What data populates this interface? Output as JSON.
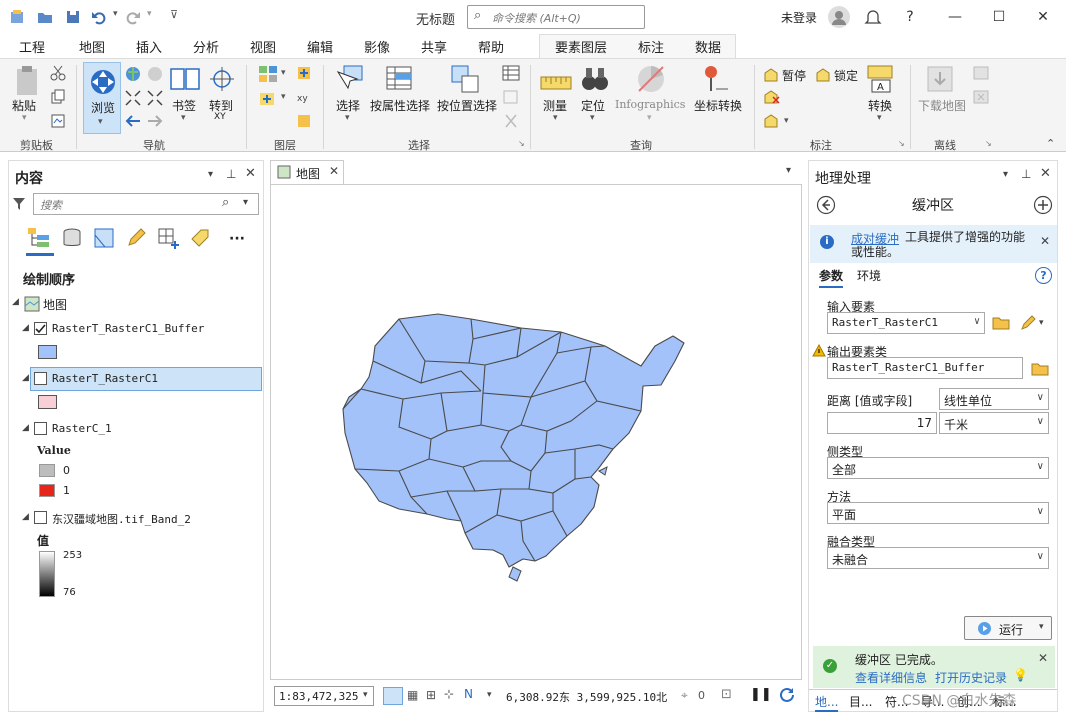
{
  "app": {
    "title": "无标题",
    "command_search_placeholder": "命令搜索 (Alt+Q)",
    "login": "未登录"
  },
  "tabs": [
    "工程",
    "地图",
    "插入",
    "分析",
    "视图",
    "编辑",
    "影像",
    "共享",
    "帮助"
  ],
  "active_tab": "地图",
  "context_tabs": [
    "要素图层",
    "标注",
    "数据"
  ],
  "ribbon": {
    "clipboard": {
      "paste": "粘贴",
      "group": "剪贴板"
    },
    "navigate": {
      "explore": "浏览",
      "bookmarks": "书签",
      "goto": "转到",
      "goto_sub": "XY",
      "group": "导航"
    },
    "layer": {
      "group": "图层"
    },
    "selection": {
      "select": "选择",
      "by_attr": "按属性选择",
      "by_loc": "按位置选择",
      "group": "选择"
    },
    "inquiry": {
      "measure": "测量",
      "locate": "定位",
      "infographics": "Infographics",
      "convert_coords": "坐标转换",
      "group": "查询"
    },
    "labeling": {
      "pause": "暂停",
      "lock": "锁定",
      "convert": "转换",
      "group": "标注"
    },
    "offline": {
      "download_map": "下载地图",
      "group": "离线"
    }
  },
  "contents": {
    "title": "内容",
    "search_placeholder": "搜索",
    "draw_order": "绘制顺序",
    "map_name": "地图",
    "layers": [
      {
        "name": "RasterT_RasterC1_Buffer",
        "checked": true,
        "swatch": "#a3c2fa"
      },
      {
        "name": "RasterT_RasterC1",
        "checked": false,
        "swatch": "#f9cfd6",
        "selected": true
      },
      {
        "name": "RasterC_1",
        "checked": false,
        "legend_title": "Value",
        "classes": [
          {
            "label": "0",
            "color": "#bdbdbd"
          },
          {
            "label": "1",
            "color": "#e8251b"
          }
        ]
      },
      {
        "name": "东汉疆域地图.tif_Band_2",
        "checked": false,
        "legend_title": "值",
        "high": "253",
        "low": "76"
      }
    ]
  },
  "map_view": {
    "tab_label": "地图",
    "fill_color": "#a3c2fa",
    "scale": "1:83,472,325",
    "coords": "6,308.92东  3,599,925.10北",
    "selected_count": "0"
  },
  "geoprocessing": {
    "title": "地理处理",
    "tool_name": "缓冲区",
    "info_link": "成对缓冲",
    "info_text": "工具提供了增强的功能或性能。",
    "tab_params": "参数",
    "tab_env": "环境",
    "input_label": "输入要素",
    "input_value": "RasterT_RasterC1",
    "output_label": "输出要素类",
    "output_value": "RasterT_RasterC1_Buffer",
    "distance_label": "距离 [值或字段]",
    "distance_type": "线性单位",
    "distance_value": "17",
    "distance_unit": "千米",
    "side_label": "侧类型",
    "side_value": "全部",
    "method_label": "方法",
    "method_value": "平面",
    "dissolve_label": "融合类型",
    "dissolve_value": "未融合",
    "run": "运行",
    "status_title": "缓冲区 已完成。",
    "status_details": "查看详细信息",
    "status_history": "打开历史记录"
  },
  "bottom_tabs": [
    "地...",
    "目...",
    "符...",
    "导...",
    "创...",
    "标..."
  ],
  "watermark": "CSDN @白水先森"
}
